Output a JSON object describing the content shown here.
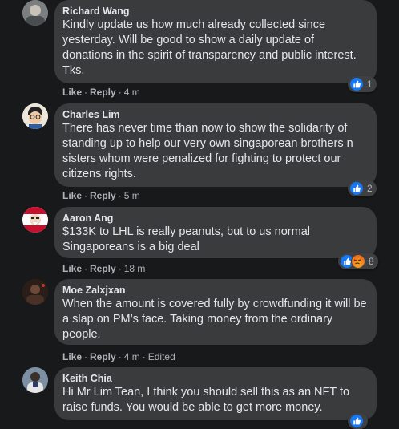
{
  "comments": [
    {
      "author": "Richard Wang",
      "text": "Kindly update us how much already collected since yesterday. Will be good to show a daily update of donations in the spirit of transparency and public interest. Tks.",
      "actions": {
        "like": "Like",
        "reply": "Reply",
        "time": "4 m",
        "edited": ""
      },
      "reactions": {
        "types": [
          "like"
        ],
        "count": "1"
      }
    },
    {
      "author": "Charles Lim",
      "text": "There has never time than now to show the solidarity of standing up to help our very own singaporean brothers n sisters whom were penalized for fighting to protect our citizens rights.",
      "actions": {
        "like": "Like",
        "reply": "Reply",
        "time": "5 m",
        "edited": ""
      },
      "reactions": {
        "types": [
          "like"
        ],
        "count": "2"
      }
    },
    {
      "author": "Aaron Ang",
      "text": "$133K to LHL is really peanuts, but to us normal Singaporeans is a big deal",
      "actions": {
        "like": "Like",
        "reply": "Reply",
        "time": "18 m",
        "edited": ""
      },
      "reactions": {
        "types": [
          "like",
          "angry"
        ],
        "count": "8"
      }
    },
    {
      "author": "Moe Zalxjxan",
      "text": "When the amount is covered fully by crowdfunding it will be a slap on PM’s face. Taking money from the ordinary people.",
      "actions": {
        "like": "Like",
        "reply": "Reply",
        "time": "4 m",
        "edited": "Edited"
      },
      "reactions": null
    },
    {
      "author": "Keith Chia",
      "text": "Hi Mr Lim Tean, I think you should sell this as an NFT to raise funds. You would be able to get more money.",
      "actions": {
        "like": "Like",
        "reply": "Reply",
        "time": "",
        "edited": ""
      },
      "reactions": {
        "types": [
          "like"
        ],
        "count": ""
      }
    }
  ],
  "colors": {
    "background": "#18191a",
    "bubble": "#3a3b3c",
    "text": "#e4e6eb",
    "meta": "#b0b3b8",
    "like": "#1877f2"
  }
}
